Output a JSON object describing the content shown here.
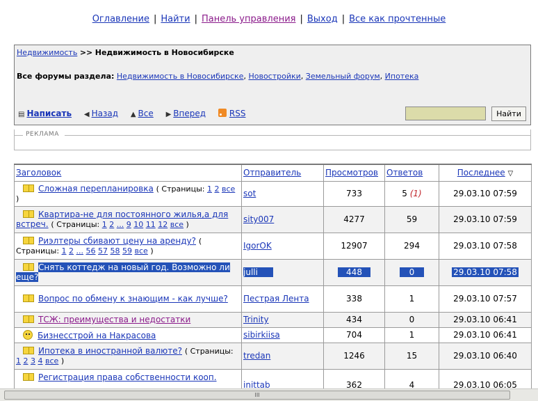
{
  "topnav": {
    "contents": "Оглавление",
    "find": "Найти",
    "control_panel": "Панель управления",
    "logout": "Выход",
    "mark_all_read": "Все как прочтенные"
  },
  "breadcrumb": {
    "root": "Недвижимость",
    "separator": ">>",
    "current": "Недвижимость в Новосибирске"
  },
  "forums": {
    "label": "Все форумы раздела:",
    "items": [
      "Недвижимость в Новосибирске",
      "Новостройки",
      "Земельный форум",
      "Ипотека"
    ]
  },
  "toolbar": {
    "write": "Написать",
    "back": "Назад",
    "all": "Все",
    "forward": "Вперед",
    "rss": "RSS",
    "search_value": "",
    "search_button": "Найти"
  },
  "ad": {
    "legend": "РЕКЛАМА"
  },
  "table": {
    "headers": {
      "title": "Заголовок",
      "author": "Отправитель",
      "views": "Просмотров",
      "replies": "Ответов",
      "last": "Последнее",
      "sort_icon": "▽"
    },
    "pages_label": "Страницы:",
    "rows": [
      {
        "title": "Сложная перепланировка",
        "pages_prefix": "( Страницы:",
        "pages": [
          "1",
          "2",
          "все"
        ],
        "pages_suffix": ")",
        "author": "sot",
        "views": "733",
        "replies": "5",
        "new": "(1)",
        "last": "29.03.10 07:59"
      },
      {
        "title": "Квартира-не для постоянного жилья,а для встреч.",
        "pages_prefix": "( Страницы:",
        "pages": [
          "1",
          "2",
          "...",
          "9",
          "10",
          "11",
          "12",
          "все"
        ],
        "pages_suffix": ")",
        "author": "sity007",
        "views": "4277",
        "replies": "59",
        "new": "",
        "last": "29.03.10 07:59"
      },
      {
        "title": "Риэлтеры сбивают цену на аренду?",
        "pages_prefix": "( Страницы:",
        "pages": [
          "1",
          "2",
          "...",
          "56",
          "57",
          "58",
          "59",
          "все"
        ],
        "pages_suffix": ")",
        "author": "IgorOK",
        "views": "12907",
        "replies": "294",
        "new": "",
        "last": "29.03.10 07:58"
      },
      {
        "title": "Снять коттедж на новый год. Возможно ли еще?",
        "author": "julli",
        "views": "448",
        "replies": "0",
        "new": "",
        "last": "29.03.10 07:58"
      },
      {
        "title": "Вопрос по обмену к знающим - как лучше?",
        "author": "Пестрая Лента",
        "views": "338",
        "replies": "1",
        "new": "",
        "last": "29.03.10 07:57"
      },
      {
        "title": "ТСЖ: преимущества и недостатки",
        "author": "Trinity",
        "views": "434",
        "replies": "0",
        "new": "",
        "last": "29.03.10 06:41"
      },
      {
        "title": "Бизнесстрой на Накрасова",
        "author": "sibirkiisa",
        "views": "704",
        "replies": "1",
        "new": "",
        "last": "29.03.10 06:41"
      },
      {
        "title": "Ипотека в иностранной валюте?",
        "pages_prefix": "( Страницы:",
        "pages": [
          "1",
          "2",
          "3",
          "4",
          "все"
        ],
        "pages_suffix": ")",
        "author": "tredan",
        "views": "1246",
        "replies": "15",
        "new": "",
        "last": "29.03.10 06:40"
      },
      {
        "title": "Регистрация права собственности кооп.",
        "author": "inittab",
        "views": "362",
        "replies": "4",
        "new": "",
        "last": "29.03.10 06:05"
      }
    ]
  },
  "scrollbar": {
    "grip": "III"
  }
}
